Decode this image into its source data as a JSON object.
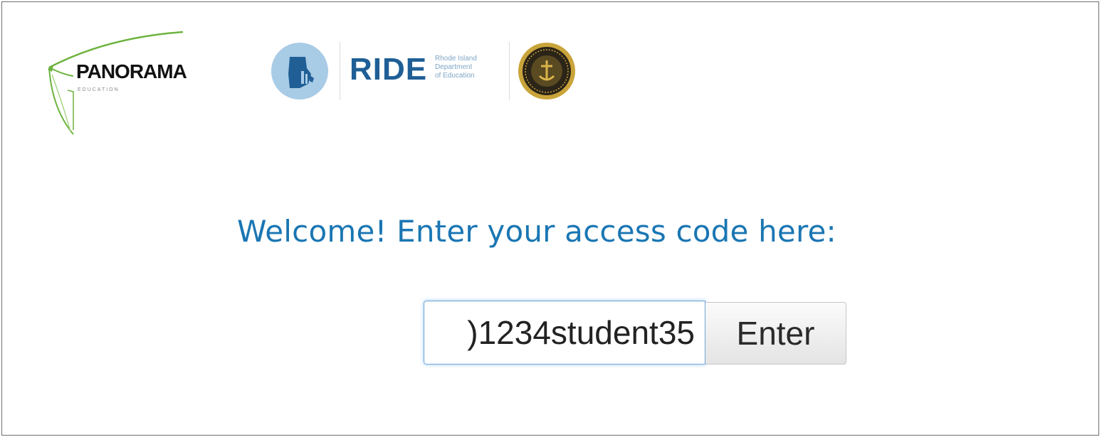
{
  "logos": {
    "panorama": {
      "name": "PANORAMA",
      "tagline": "EDUCATION"
    },
    "ride": {
      "name": "RIDE",
      "subtitle_lines": [
        "Rhode Island",
        "Department",
        "of Education"
      ]
    },
    "seal_icon": "state-seal-icon",
    "colors": {
      "panorama_swoosh": "#6db33f",
      "ride_blue": "#1f5f96",
      "ride_circle": "#a8cbe6",
      "seal_gold": "#c9a43a"
    }
  },
  "welcome": {
    "heading": "Welcome! Enter your access code here:",
    "color": "#1a76b3"
  },
  "form": {
    "access_code_value": ")1234student35",
    "enter_label": "Enter",
    "focus_color": "#74a9da"
  }
}
